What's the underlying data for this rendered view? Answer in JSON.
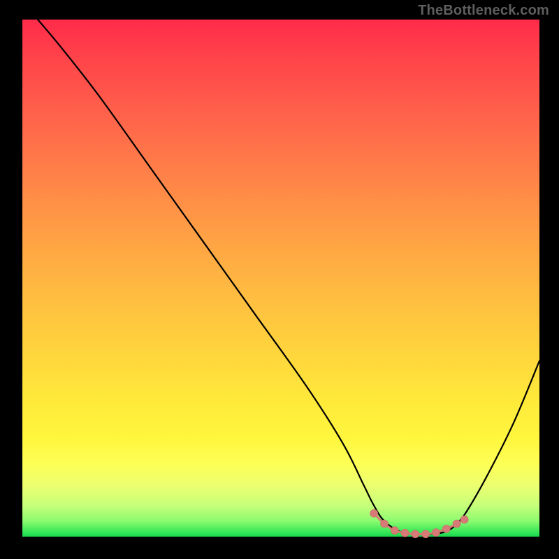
{
  "watermark": "TheBottleneck.com",
  "colors": {
    "curve": "#000000",
    "bead_fill": "#d77b77",
    "bead_stroke": "#c96a66",
    "background_black": "#000000",
    "gradient_top": "#ff2b4a",
    "gradient_bottom": "#18d74e"
  },
  "chart_data": {
    "type": "line",
    "title": "",
    "xlabel": "",
    "ylabel": "",
    "xlim": [
      0,
      100
    ],
    "ylim": [
      0,
      100
    ],
    "grid": false,
    "legend": false,
    "series": [
      {
        "name": "bottleneck-curve",
        "x": [
          3,
          8,
          15,
          25,
          35,
          45,
          55,
          62,
          66,
          68,
          70,
          73,
          76,
          79,
          82,
          84,
          86,
          90,
          95,
          100
        ],
        "y": [
          100,
          94,
          85,
          71,
          57,
          43,
          29,
          18,
          10,
          6,
          3,
          1,
          0.5,
          0.5,
          1,
          2.5,
          5,
          12,
          22,
          34
        ]
      }
    ],
    "highlight_beads": {
      "name": "red-dots-near-minimum",
      "x": [
        68,
        70,
        72,
        74,
        76,
        78,
        80,
        82,
        84,
        85.5
      ],
      "y": [
        4.5,
        2.5,
        1.2,
        0.7,
        0.5,
        0.5,
        0.8,
        1.5,
        2.5,
        3.3
      ]
    }
  }
}
